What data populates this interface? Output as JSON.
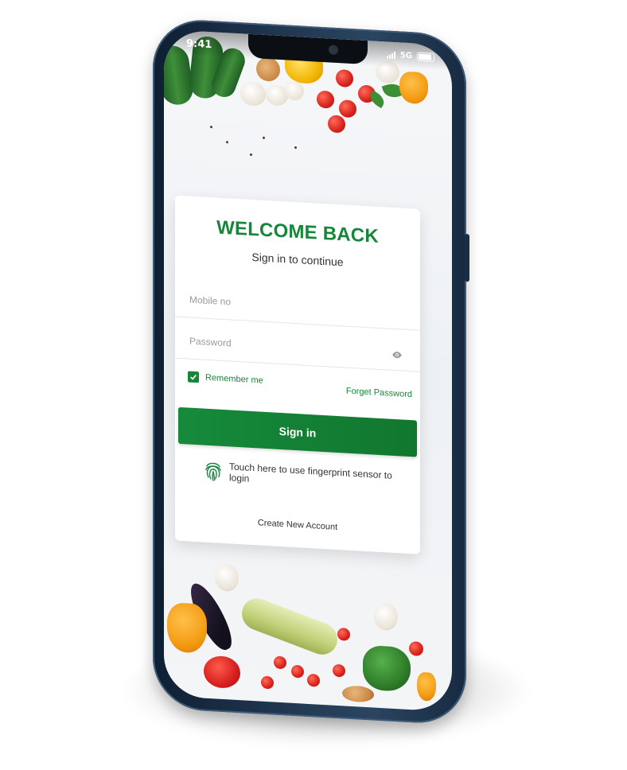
{
  "status_bar": {
    "time": "9:41",
    "network": "5G"
  },
  "card": {
    "title": "WELCOME BACK",
    "subtitle": "Sign in to continue",
    "mobile_placeholder": "Mobile no",
    "password_placeholder": "Password",
    "remember_label": "Remember me",
    "remember_checked": true,
    "forget_label": "Forget Password",
    "signin_label": "Sign in",
    "fingerprint_text": "Touch here to use fingerprint sensor to login",
    "create_account_label": "Create New Account"
  },
  "colors": {
    "brand_green": "#17863b",
    "phone_frame": "#20364f"
  },
  "icons": {
    "password_toggle": "eye-icon",
    "checkbox": "check-icon",
    "fingerprint": "fingerprint-icon"
  }
}
